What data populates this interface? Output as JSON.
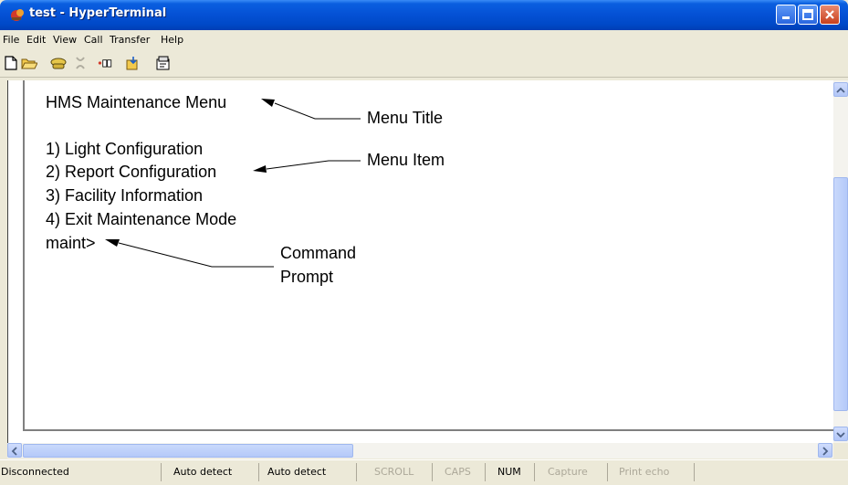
{
  "window": {
    "title": "test - HyperTerminal"
  },
  "menu": [
    "File",
    "Edit",
    "View",
    "Call",
    "Transfer",
    "Help"
  ],
  "toolbar": {
    "icons": [
      "new-document-icon",
      "open-folder-icon",
      "call-icon",
      "disconnect-icon",
      "send-icon",
      "receive-icon",
      "properties-icon"
    ]
  },
  "terminal": {
    "title": "HMS Maintenance Menu",
    "items": [
      "1)  Light Configuration",
      "2)  Report Configuration",
      "3)  Facility Information",
      "4)  Exit Maintenance Mode"
    ],
    "prompt": "maint>"
  },
  "annotations": {
    "menu_title": "Menu Title",
    "menu_item": "Menu Item",
    "command_prompt_line1": "Command",
    "command_prompt_line2": "Prompt"
  },
  "status": {
    "connection": "Disconnected",
    "detect1": "Auto detect",
    "detect2": "Auto detect",
    "scroll": "SCROLL",
    "caps": "CAPS",
    "num": "NUM",
    "capture": "Capture",
    "print_echo": "Print echo"
  },
  "colors": {
    "titlebar": "#0552d6",
    "window_bg": "#ece9d8",
    "close_button": "#c8401d"
  }
}
